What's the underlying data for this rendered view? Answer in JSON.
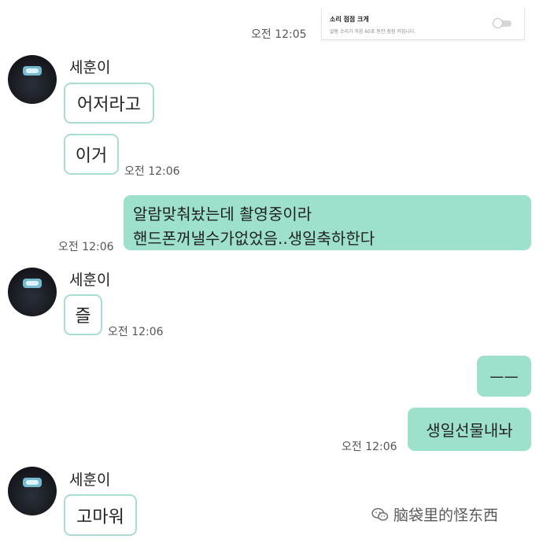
{
  "settings": {
    "title": "소리 점점 크게",
    "subtitle": "알람 소리가 처음 60초 동안 점점 커집니다."
  },
  "messages": {
    "ts_top": "오전 12:05",
    "sender_name": "세훈이",
    "m1": "어저라고",
    "m2": "이거",
    "m2_time": "오전 12:06",
    "m3_line1": "알람맞춰놨는데 촬영중이라",
    "m3_line2": "핸드폰꺼낼수가없었음..생일축하한다",
    "m3_time": "오전 12:06",
    "m4": "즐",
    "m4_time": "오전 12:06",
    "m5": "ㅡㅡ",
    "m6": "생일선물내놔",
    "m6_time": "오전 12:06",
    "m7": "고마워"
  },
  "watermark": {
    "text": "脑袋里的怪东西",
    "icon": "wechat-icon"
  },
  "colors": {
    "outgoing_bubble": "#9de0cc",
    "incoming_border": "#a9ddd3"
  }
}
